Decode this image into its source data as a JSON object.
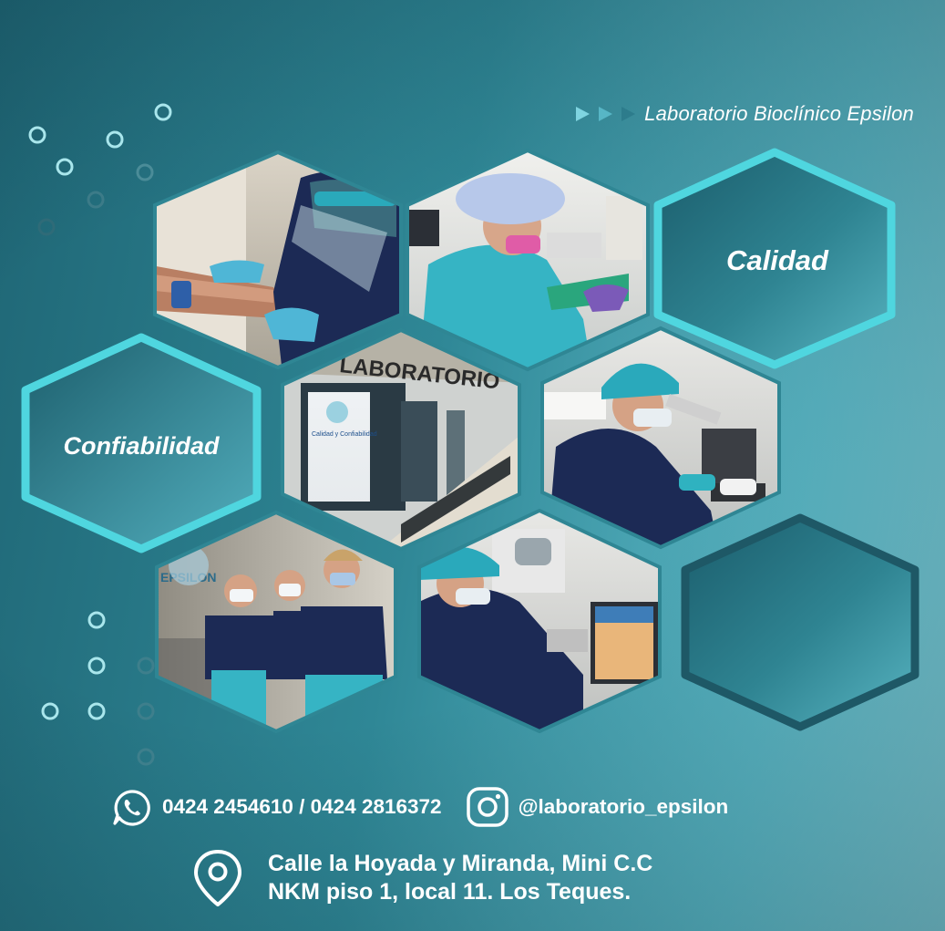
{
  "header": {
    "title": "Laboratorio Bioclínico Epsilon",
    "arrow_icons": [
      "play-arrow-icon",
      "play-arrow-icon",
      "play-arrow-icon"
    ]
  },
  "values": {
    "quality": "Calidad",
    "reliability": "Confiabilidad"
  },
  "photos": [
    {
      "name": "photo-blood-draw",
      "subject": "blood draw"
    },
    {
      "name": "photo-lab-technician",
      "subject": "lab technician"
    },
    {
      "name": "photo-lab-facade",
      "subject": "laboratory entrance"
    },
    {
      "name": "photo-microscope",
      "subject": "microscope"
    },
    {
      "name": "photo-staff-team",
      "subject": "staff team"
    },
    {
      "name": "photo-analyzer",
      "subject": "analyzer"
    }
  ],
  "photo_signage": {
    "facade_sign": "LABORATORIO",
    "poster_line": "Calidad y Confiabilidad",
    "wall_logo": "EPSILON"
  },
  "contact": {
    "phone_icon": "whatsapp-icon",
    "phones": "0424 2454610 / 0424 2816372",
    "instagram_icon": "instagram-icon",
    "instagram": "@laboratorio_epsilon"
  },
  "address": {
    "icon": "location-pin-icon",
    "line1": "Calle la Hoyada y Miranda, Mini C.C",
    "line2": "NKM piso 1, local 11. Los Teques."
  },
  "colors": {
    "accent": "#4fd6df",
    "teal_dark": "#1f6675",
    "teal_light": "#7ccad5",
    "scrub_navy": "#1c2a55",
    "scrub_teal": "#36b4c4",
    "white": "#ffffff"
  }
}
